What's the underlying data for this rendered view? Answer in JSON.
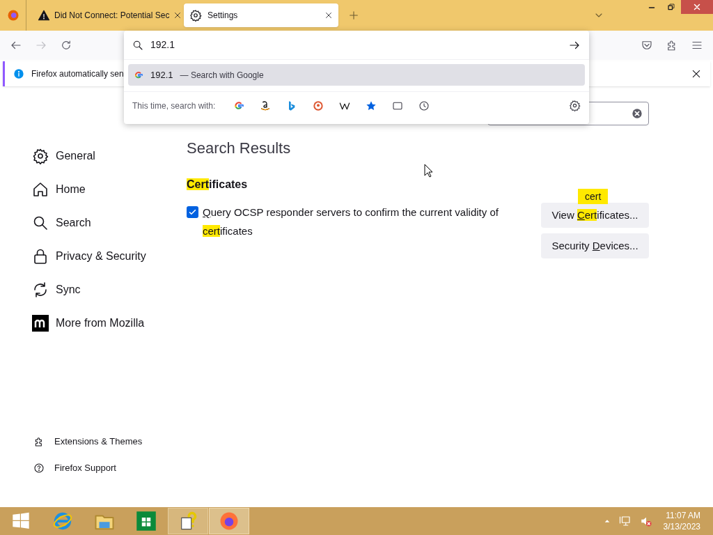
{
  "tabs": [
    {
      "title": "Did Not Connect: Potential Sec",
      "kind": "warning",
      "selected": false
    },
    {
      "title": "Settings",
      "kind": "settings",
      "selected": true
    }
  ],
  "urlbar": {
    "value": "192.1",
    "suggestion": {
      "value": "192.1",
      "action": "— Search with Google",
      "selected": true
    },
    "one_off_label": "This time, search with:"
  },
  "notification": {
    "text": "Firefox automatically sen"
  },
  "sidebar": {
    "items": [
      {
        "label": "General",
        "kind": "gear",
        "selected": false
      },
      {
        "label": "Home",
        "kind": "home",
        "selected": false
      },
      {
        "label": "Search",
        "kind": "search",
        "selected": false
      },
      {
        "label": "Privacy & Security",
        "kind": "lock",
        "selected": false
      },
      {
        "label": "Sync",
        "kind": "sync",
        "selected": false
      },
      {
        "label": "More from Mozilla",
        "kind": "mozilla",
        "selected": false
      }
    ],
    "footer": [
      {
        "label": "Extensions & Themes",
        "kind": "puzzle"
      },
      {
        "label": "Firefox Support",
        "kind": "help"
      }
    ]
  },
  "main": {
    "title": "Search Results",
    "heading": [
      {
        "text": "Cert",
        "kind": "highlight"
      },
      {
        "text": "ificates",
        "kind": "plain"
      }
    ],
    "checkbox": {
      "checked": true,
      "label": [
        {
          "text": "Q",
          "kind": "underline"
        },
        {
          "text": "uery OCSP responder servers to confirm the current validity of ",
          "kind": "plain"
        },
        {
          "text": "cert",
          "kind": "highlight"
        },
        {
          "text": "ificates",
          "kind": "plain"
        }
      ]
    },
    "buttons": [
      {
        "label": [
          {
            "text": "View ",
            "kind": "plain"
          },
          {
            "text": "C",
            "kind": "both"
          },
          {
            "text": "ert",
            "kind": "highlight"
          },
          {
            "text": "ificates...",
            "kind": "plain"
          }
        ],
        "tooltip": "cert"
      },
      {
        "label": [
          {
            "text": "Security ",
            "kind": "plain"
          },
          {
            "text": "D",
            "kind": "underline"
          },
          {
            "text": "evices...",
            "kind": "plain"
          }
        ]
      }
    ]
  },
  "taskbar": {
    "time": "11:07 AM",
    "date": "3/13/2023"
  }
}
